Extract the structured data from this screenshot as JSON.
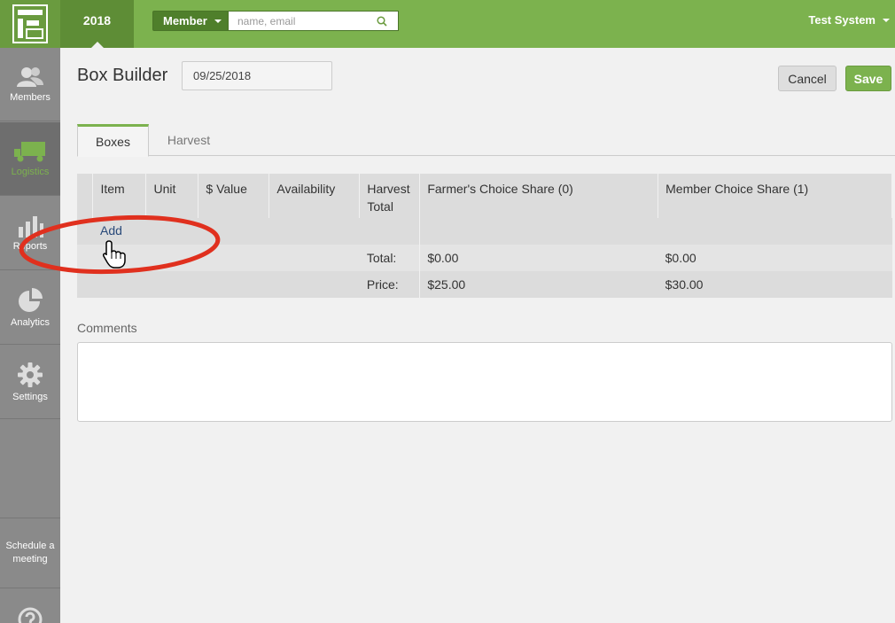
{
  "header": {
    "year": "2018",
    "member_dropdown": "Member",
    "search_placeholder": "name, email",
    "user_menu": "Test System"
  },
  "sidebar": {
    "items": [
      {
        "label": "Members",
        "icon": "members-icon"
      },
      {
        "label": "Logistics",
        "icon": "truck-icon",
        "active": true
      },
      {
        "label": "Reports",
        "icon": "bar-chart-icon"
      },
      {
        "label": "Analytics",
        "icon": "pie-chart-icon"
      },
      {
        "label": "Settings",
        "icon": "gear-icon"
      }
    ],
    "schedule": "Schedule a meeting"
  },
  "page": {
    "title": "Box Builder",
    "date": "09/25/2018",
    "cancel_label": "Cancel",
    "save_label": "Save"
  },
  "tabs": [
    {
      "label": "Boxes",
      "active": true
    },
    {
      "label": "Harvest",
      "active": false
    }
  ],
  "table": {
    "headers": [
      "Item",
      "Unit",
      "$ Value",
      "Availability",
      "Harvest Total",
      "Farmer's Choice Share (0)",
      "Member Choice Share (1)"
    ],
    "add_label": "Add",
    "total_label": "Total:",
    "total_values": [
      "$0.00",
      "$0.00"
    ],
    "price_label": "Price:",
    "price_values": [
      "$25.00",
      "$30.00"
    ]
  },
  "comments": {
    "label": "Comments",
    "value": ""
  },
  "colors": {
    "brand_green": "#7cb24e",
    "sidebar_gray": "#8a8a8a",
    "annotation_red": "#e0301e"
  }
}
